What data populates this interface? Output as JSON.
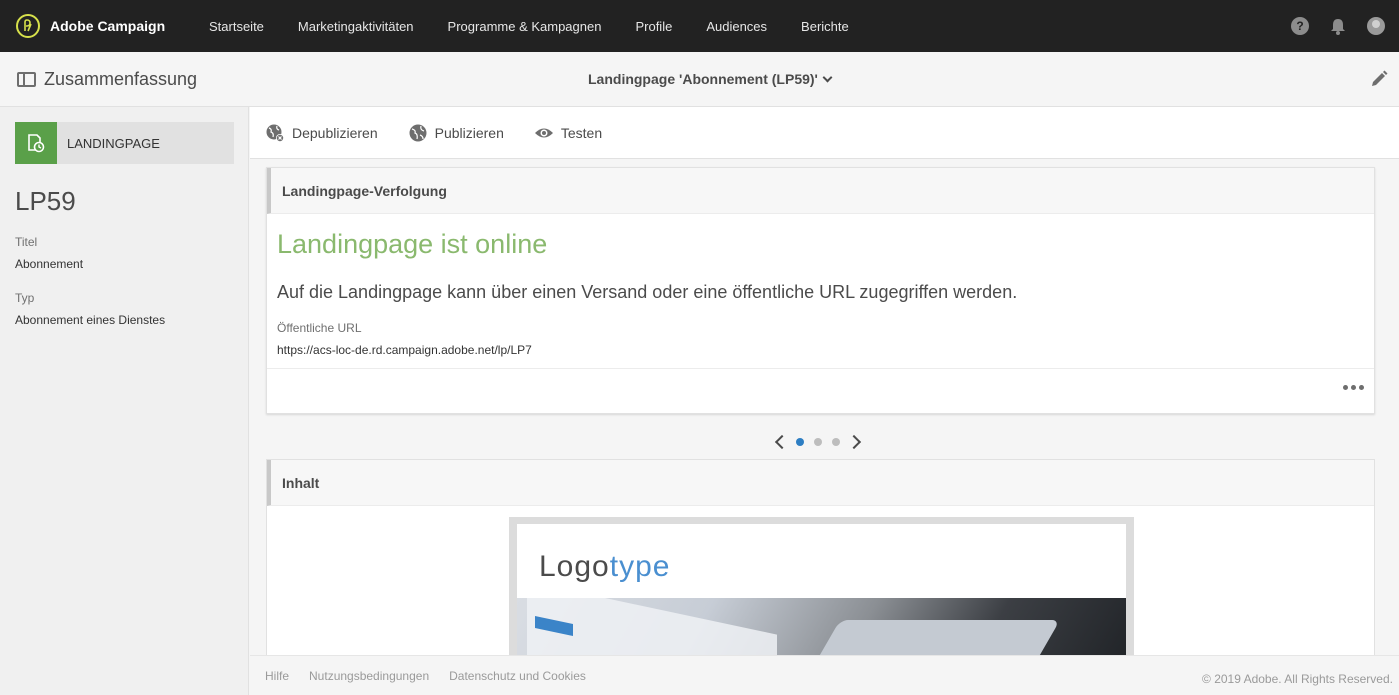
{
  "app": {
    "name": "Adobe Campaign"
  },
  "nav": [
    "Startseite",
    "Marketingaktivitäten",
    "Programme & Kampagnen",
    "Profile",
    "Audiences",
    "Berichte"
  ],
  "header": {
    "summary_label": "Zusammenfassung",
    "title": "Landingpage 'Abonnement (LP59)'"
  },
  "sidebar": {
    "type_label": "LANDINGPAGE",
    "id": "LP59",
    "title_label": "Titel",
    "title_value": "Abonnement",
    "type_field_label": "Typ",
    "type_field_value": "Abonnement eines Dienstes"
  },
  "toolbar": {
    "unpublish": "Depublizieren",
    "publish": "Publizieren",
    "test": "Testen"
  },
  "tracking_card": {
    "header": "Landingpage-Verfolgung",
    "status": "Landingpage ist online",
    "description": "Auf die Landingpage kann über einen Versand oder eine öffentliche URL zugegriffen werden.",
    "url_label": "Öffentliche URL",
    "url_value": "https://acs-loc-de.rd.campaign.adobe.net/lp/LP7"
  },
  "carousel": {
    "pages": 3,
    "active": 1
  },
  "content_card": {
    "header": "Inhalt",
    "logo_main": "Logo",
    "logo_accent": "type"
  },
  "footer": {
    "links": [
      "Hilfe",
      "Nutzungsbedingungen",
      "Datenschutz und Cookies"
    ],
    "copyright": "© 2019 Adobe. All Rights Reserved."
  },
  "colors": {
    "topbar": "#222222",
    "brand_accent": "#d7e14b",
    "online_green": "#8ab96e",
    "type_icon_green": "#5aa049",
    "carousel_active": "#2d7ec3"
  }
}
